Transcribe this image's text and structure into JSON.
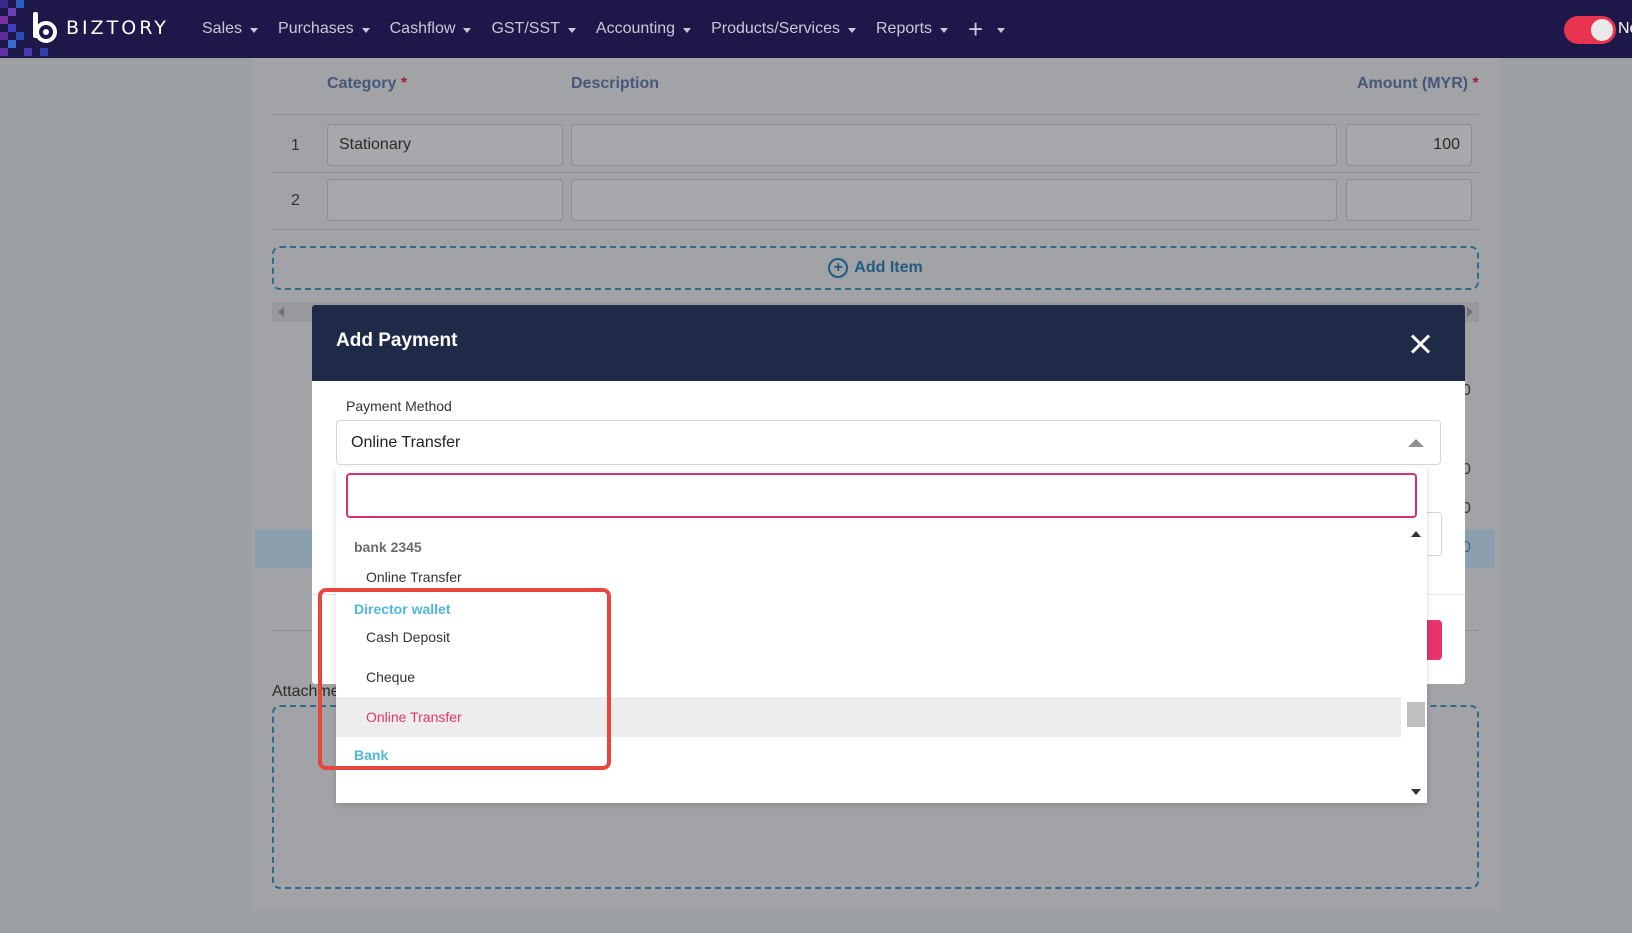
{
  "app": {
    "logo_text": "BIZTORY",
    "nav_items": [
      "Sales",
      "Purchases",
      "Cashflow",
      "GST/SST",
      "Accounting",
      "Products/Services",
      "Reports"
    ],
    "nav_plus": "+",
    "nav_truncated": "Ne"
  },
  "table": {
    "headers": {
      "category": "Category",
      "description": "Description",
      "amount": "Amount (MYR)",
      "required_mark": "*"
    },
    "rows": [
      {
        "num": "1",
        "category": "Stationary",
        "description": "",
        "amount": "100"
      },
      {
        "num": "2",
        "category": "",
        "description": "",
        "amount": ""
      }
    ],
    "add_item_label": "Add Item"
  },
  "background": {
    "peek_values": [
      "0",
      "0",
      "0",
      "0"
    ],
    "attach_label": "Attachme"
  },
  "modal": {
    "title": "Add Payment",
    "payment_method_label": "Payment Method",
    "payment_method_value": "Online Transfer"
  },
  "dropdown": {
    "search_value": "",
    "groups": [
      {
        "name": "bank 2345",
        "style": "muted",
        "options": [
          "Online Transfer"
        ]
      },
      {
        "name": "Director wallet",
        "style": "accent",
        "options": [
          "Cash Deposit",
          "Cheque",
          "Online Transfer"
        ]
      },
      {
        "name": "Bank",
        "style": "accent",
        "options": []
      }
    ],
    "selected": "Director wallet / Online Transfer"
  },
  "colors": {
    "navbar": "#1d1849",
    "modal_header": "#1e2a47",
    "accent_pink": "#e8336b",
    "group_blue": "#4fb7dc",
    "highlight": "#e8453f"
  }
}
